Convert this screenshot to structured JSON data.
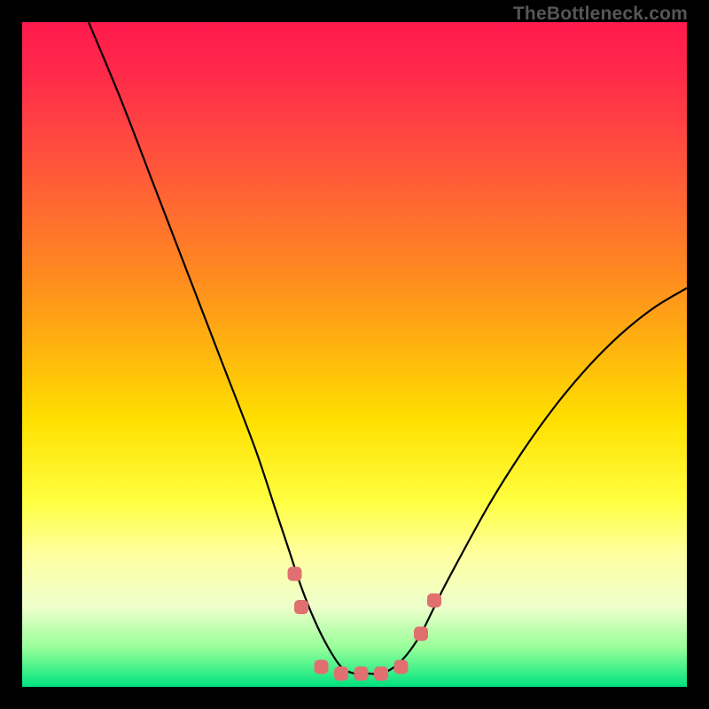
{
  "watermark": "TheBottleneck.com",
  "chart_data": {
    "type": "line",
    "title": "",
    "xlabel": "",
    "ylabel": "",
    "xlim": [
      0,
      100
    ],
    "ylim": [
      0,
      100
    ],
    "series": [
      {
        "name": "curve",
        "x": [
          10,
          15,
          20,
          25,
          30,
          35,
          38,
          40,
          42,
          44,
          46,
          48,
          50,
          52,
          54,
          56,
          58,
          60,
          62,
          64,
          70,
          75,
          80,
          85,
          90,
          95,
          100
        ],
        "y": [
          100,
          88,
          75,
          62,
          49,
          36,
          27,
          21,
          15,
          10,
          6,
          3,
          2,
          2,
          2,
          3,
          5,
          8,
          12,
          16,
          27,
          35,
          42,
          48,
          53,
          57,
          60
        ]
      }
    ],
    "markers": [
      {
        "x": 41,
        "y": 17
      },
      {
        "x": 42,
        "y": 12
      },
      {
        "x": 45,
        "y": 3
      },
      {
        "x": 48,
        "y": 2
      },
      {
        "x": 51,
        "y": 2
      },
      {
        "x": 54,
        "y": 2
      },
      {
        "x": 57,
        "y": 3
      },
      {
        "x": 60,
        "y": 8
      },
      {
        "x": 62,
        "y": 13
      }
    ],
    "marker_color": "#e07070",
    "curve_color": "#000000",
    "grid": false
  }
}
